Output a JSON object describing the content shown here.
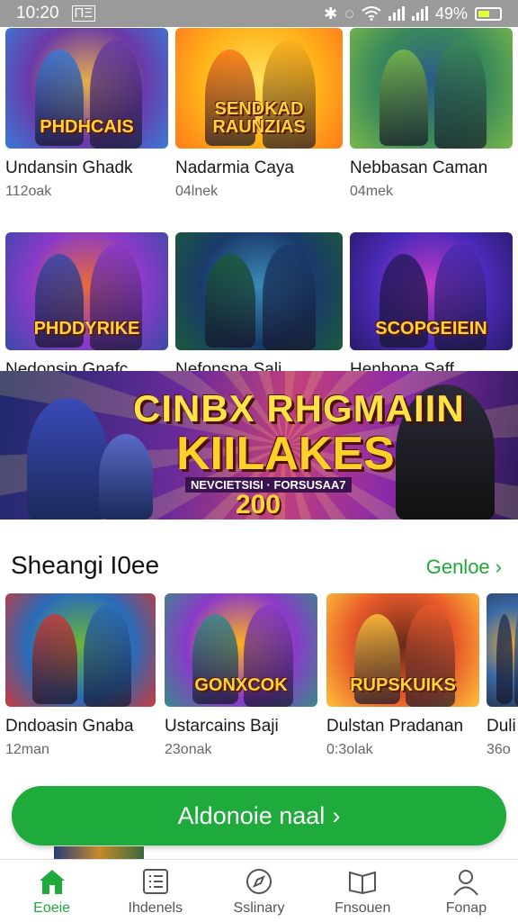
{
  "status_bar": {
    "time": "10:20",
    "left_badge": "ΠΞ",
    "bt_glyph": "✱",
    "alarm_glyph": "◌",
    "battery_text": "49%"
  },
  "top_grid": [
    {
      "name": "Undansin Ghadk",
      "sub": "112oak",
      "art_title": "PHDHCAIS",
      "colors": [
        "#6a3aa8",
        "#e8b04a",
        "#3a7ad8"
      ]
    },
    {
      "name": "Nadarmia Caya",
      "sub": "04lnek",
      "art_title": "SENDKAD RAUNZIAS",
      "colors": [
        "#ffb21a",
        "#ffe25a",
        "#ff7a1a"
      ]
    },
    {
      "name": "Nebbasan Caman",
      "sub": "04mek",
      "art_title": "",
      "colors": [
        "#3a8a5a",
        "#2a5a8a",
        "#7ab84a"
      ]
    },
    {
      "name": "Nedonsin Gnafc",
      "sub": "",
      "art_title": "PHDDYRIKE",
      "colors": [
        "#8a3ac8",
        "#e86a3a",
        "#3a4aa8"
      ]
    },
    {
      "name": "Nefonspa Sali",
      "sub": "",
      "art_title": "",
      "colors": [
        "#1a3a6a",
        "#3a8ab8",
        "#1a5a3a"
      ]
    },
    {
      "name": "Henhopa Saff",
      "sub": "",
      "art_title": "SCOPGEIEIN",
      "colors": [
        "#4a2ab8",
        "#c83ac8",
        "#2a1a6a"
      ]
    }
  ],
  "banner": {
    "title_line1": "CINBX RHGMAIIN",
    "title_line2": "KIILAKES",
    "subtitle": "NEVCIETSISI  · FORSUSAA7",
    "number": "200"
  },
  "section": {
    "title": "Sheangi I0ee",
    "link_label": "Genloe",
    "link_arrow": "›"
  },
  "row": [
    {
      "name": "Dndoasin Gnaba",
      "sub": "12man",
      "art_title": "",
      "colors": [
        "#2a6ab8",
        "#6ab83a",
        "#c83a3a"
      ]
    },
    {
      "name": "Ustarcains Baji",
      "sub": "23onak",
      "art_title": "GONXCOK",
      "colors": [
        "#8a3ac8",
        "#ffb21a",
        "#3a8a8a"
      ]
    },
    {
      "name": "Dulstan  Pradanan",
      "sub": "0:3olak",
      "art_title": "RUPSKUIKS",
      "colors": [
        "#e85a2a",
        "#6a2a1a",
        "#ffc23a"
      ]
    },
    {
      "name": "Duli",
      "sub": "36o",
      "art_title": "",
      "colors": [
        "#3a6aa8",
        "#e8a83a",
        "#2a3a5a"
      ]
    }
  ],
  "cta": {
    "label": "Aldonoie naal",
    "arrow": "›"
  },
  "bottom_nav": [
    {
      "label": "Eoeie",
      "icon": "home-icon",
      "active": true
    },
    {
      "label": "Ihdenels",
      "icon": "list-icon",
      "active": false
    },
    {
      "label": "Sslinary",
      "icon": "compass-icon",
      "active": false
    },
    {
      "label": "Fnsouen",
      "icon": "book-icon",
      "active": false
    },
    {
      "label": "Fonap",
      "icon": "person-icon",
      "active": false
    }
  ],
  "accent_color": "#1faa3c"
}
